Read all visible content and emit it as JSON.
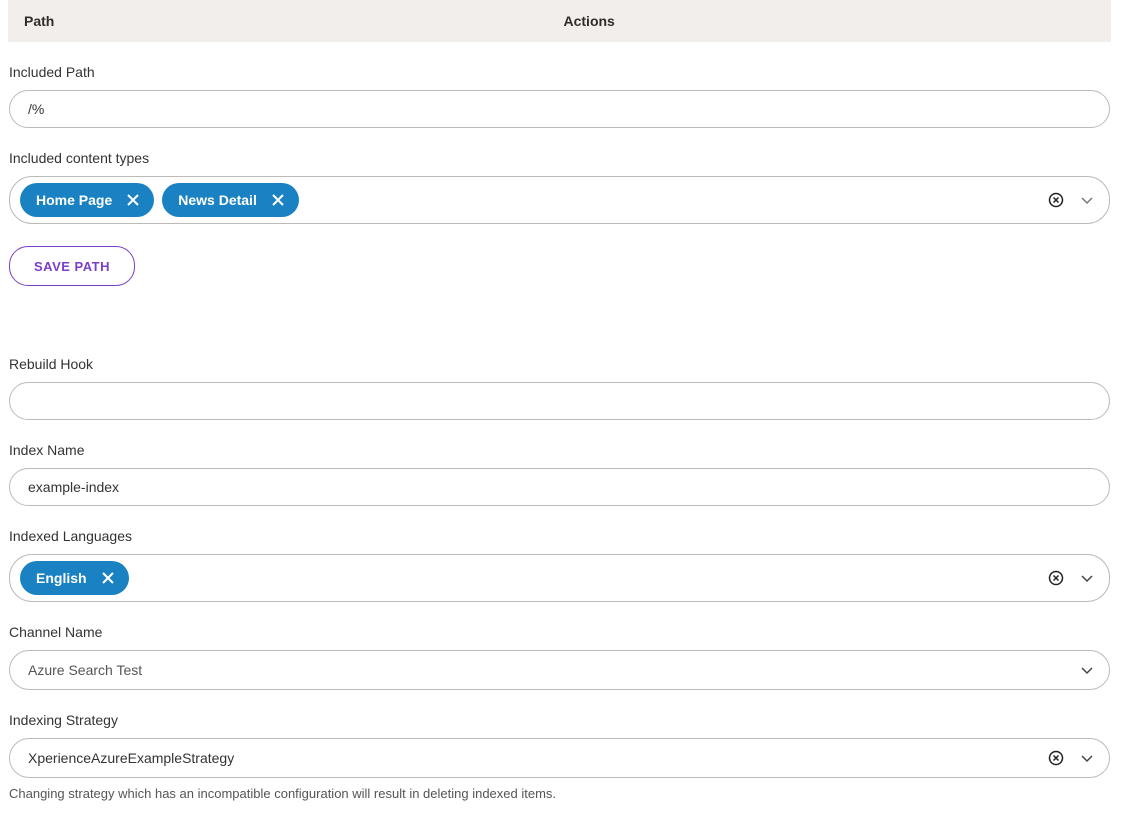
{
  "table": {
    "col_path": "Path",
    "col_actions": "Actions"
  },
  "includedPath": {
    "label": "Included Path",
    "value": "/%"
  },
  "contentTypes": {
    "label": "Included content types",
    "chips": [
      "Home Page",
      "News Detail"
    ]
  },
  "savePath": {
    "label": "SAVE PATH"
  },
  "rebuildHook": {
    "label": "Rebuild Hook",
    "value": ""
  },
  "indexName": {
    "label": "Index Name",
    "value": "example-index"
  },
  "indexedLanguages": {
    "label": "Indexed Languages",
    "chips": [
      "English"
    ]
  },
  "channel": {
    "label": "Channel Name",
    "value": "Azure Search Test"
  },
  "strategy": {
    "label": "Indexing Strategy",
    "value": "XperienceAzureExampleStrategy",
    "helper": "Changing strategy which has an incompatible configuration will result in deleting indexed items."
  }
}
